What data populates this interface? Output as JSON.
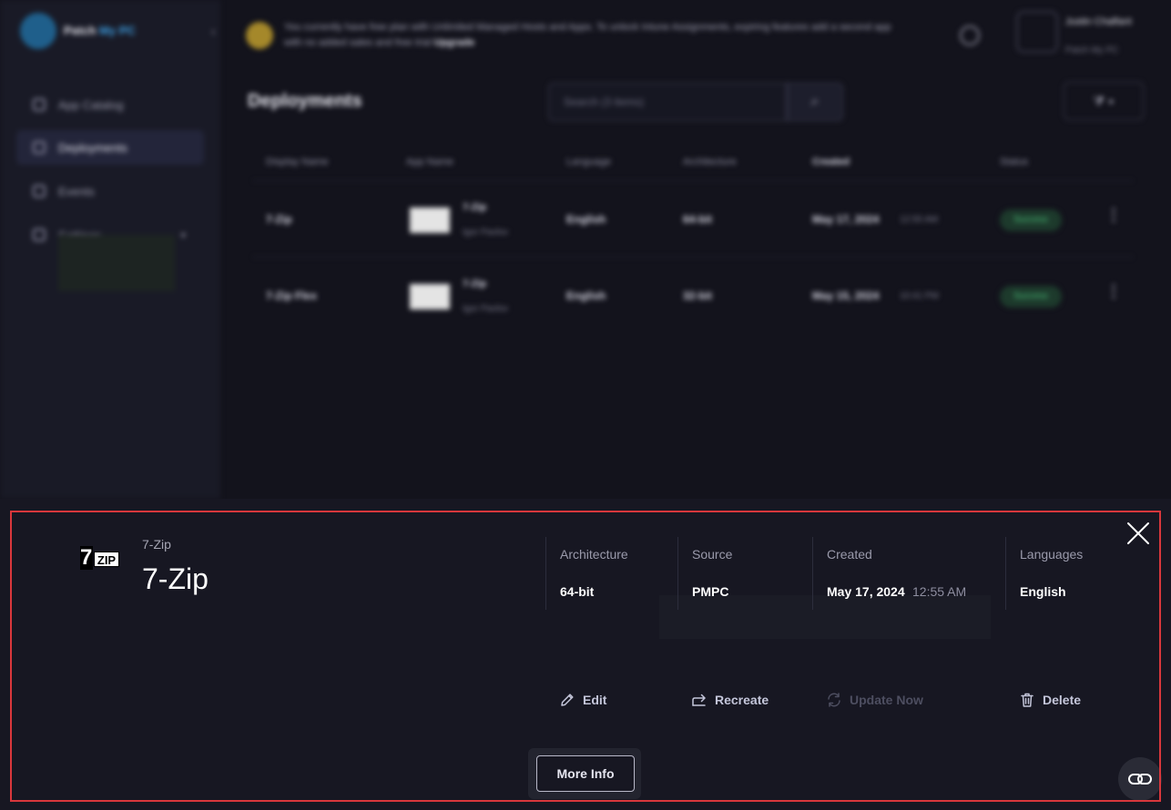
{
  "background": {
    "logo": {
      "brand_a": "Patch",
      "brand_b": "My PC"
    },
    "sidebar": {
      "items": [
        {
          "label": "App Catalog",
          "icon": "grid-icon"
        },
        {
          "label": "Deployments",
          "icon": "deploy-icon",
          "active": true
        },
        {
          "label": "Events",
          "icon": "calendar-icon"
        },
        {
          "label": "Settings",
          "icon": "gear-icon"
        }
      ]
    },
    "banner": {
      "text": "You currently have free plan with Unlimited Managed Hosts and Apps. To unlock Intune Assignments, expiring features add a second app with no added sales and free trial ",
      "link": "Upgrade"
    },
    "user": {
      "name": "Justin Chalfant",
      "sub": "Patch My PC"
    },
    "page_title": "Deployments",
    "search_placeholder": "Search (3 items)",
    "table": {
      "headers": [
        "Display Name",
        "App Name",
        "Language",
        "Architecture",
        "Created",
        "Status"
      ],
      "rows": [
        {
          "display_name": "7-Zip",
          "app_name": "7-Zip",
          "app_sub": "Igor Pavlov",
          "language": "English",
          "architecture": "64-bit",
          "created": "May 17, 2024",
          "created_time": "12:55 AM",
          "status": "Success"
        },
        {
          "display_name": "7-Zip Flex",
          "app_name": "7-Zip",
          "app_sub": "Igor Pavlov",
          "language": "English",
          "architecture": "32-bit",
          "created": "May 15, 2024",
          "created_time": "10:41 PM",
          "status": "Success"
        }
      ]
    }
  },
  "panel": {
    "app_kicker": "7-Zip",
    "app_title": "7-Zip",
    "logo_text": {
      "seven": "7",
      "zip": "ZIP"
    },
    "meta": [
      {
        "label": "Architecture",
        "value": "64-bit"
      },
      {
        "label": "Source",
        "value": "PMPC"
      },
      {
        "label": "Created",
        "value": "May 17, 2024",
        "time": "12:55 AM"
      },
      {
        "label": "Languages",
        "value": "English"
      }
    ],
    "actions": {
      "edit": "Edit",
      "recreate": "Recreate",
      "update_now": "Update Now",
      "delete": "Delete"
    },
    "more_info": "More Info"
  },
  "colors": {
    "highlight_border": "#d9373c",
    "panel_bg": "#171722",
    "action_text": "#c4c6da",
    "disabled_text": "#4d4e60"
  }
}
